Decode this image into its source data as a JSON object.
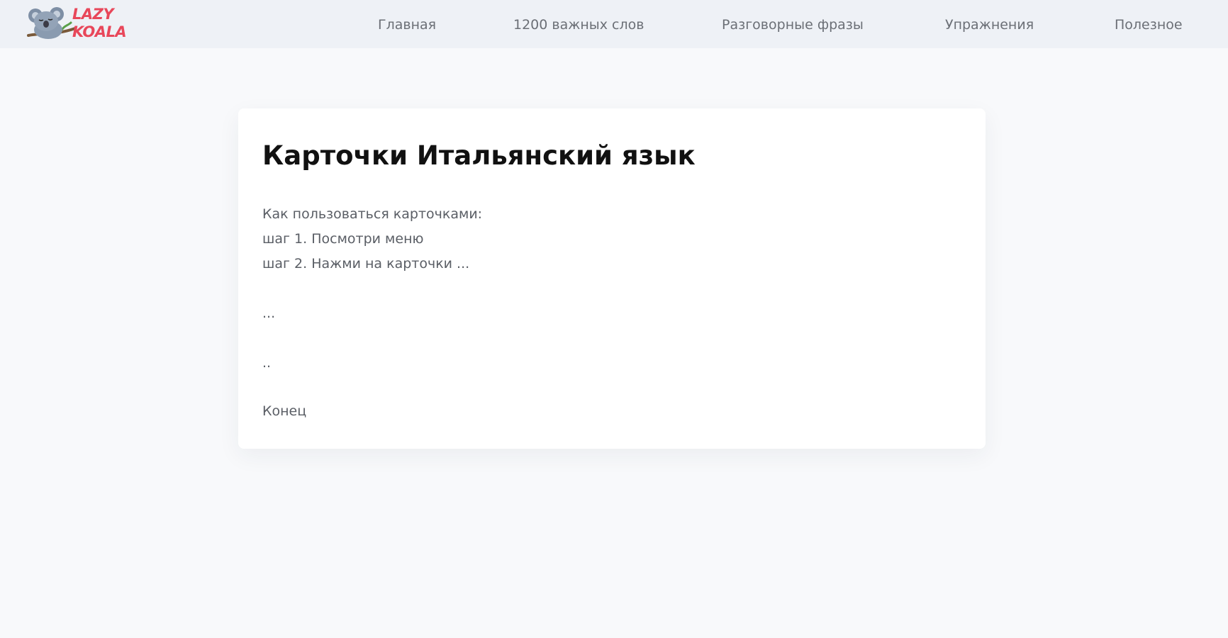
{
  "header": {
    "logo_line1": "LAZY",
    "logo_line2": "KOALA",
    "logo_icon": "koala-icon",
    "nav": [
      {
        "label": "Главная"
      },
      {
        "label": "1200 важных слов"
      },
      {
        "label": "Разговорные фразы"
      },
      {
        "label": "Упражнения"
      },
      {
        "label": "Полезное"
      }
    ]
  },
  "main": {
    "title": "Карточки Итальянский язык",
    "lines": [
      "Как пользоваться карточками:",
      "шаг 1. Посмотри меню",
      "шаг 2. Нажми на карточки ...",
      "...",
      "..",
      "Конец"
    ]
  },
  "colors": {
    "nav_background": "#eef1f6",
    "page_background": "#f8f9fb",
    "brand_red": "#e8475a",
    "koala_gray": "#8a9bb0"
  }
}
